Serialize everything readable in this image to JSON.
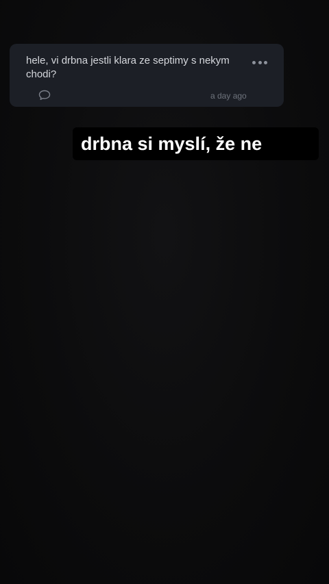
{
  "question": {
    "text": "hele, vi drbna jestli klara ze septimy s nekym chodi?",
    "timestamp": "a day ago",
    "more_icon": "more-horizontal-icon",
    "comment_icon": "comment-bubble-icon"
  },
  "caption": {
    "text": "drbna si myslí, že ne"
  },
  "colors": {
    "background": "#0b0b0c",
    "card_background": "#1c1f26",
    "card_text": "#d6d8dd",
    "muted_text": "#6f747d",
    "caption_background": "#000000",
    "caption_text": "#ffffff"
  }
}
